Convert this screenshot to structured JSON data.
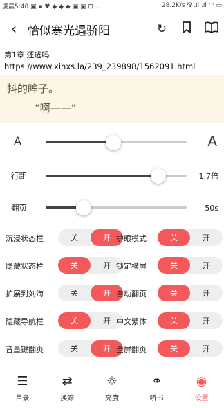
{
  "status_bar": {
    "left": "凌晨5:40 ▣ ▪ ♥ ◆ ◆ ◆ ▣ ▣ ⊡ …",
    "right": "28.2K/s ⅋ .ıl .ıl ◠ ▭"
  },
  "header": {
    "back_icon": "back-arrow-icon",
    "title": "恰似寒光遇骄阳",
    "icons": [
      "refresh-icon",
      "bookmark-icon",
      "book-icon"
    ]
  },
  "chapter": {
    "title": "第1章 还逃吗",
    "url": "https://www.xinxs.la/239_239898/1562091.html"
  },
  "reader": {
    "line1": "抖的眸子。",
    "line2": "“啊——”"
  },
  "settings": {
    "font_small": "A",
    "font_large": "A",
    "font_size_level": 0.48,
    "line_spacing": {
      "label": "行距",
      "value": "1.7倍",
      "level": 0.8
    },
    "page_turn": {
      "label": "翻页",
      "value": "50s",
      "level": 0.27
    },
    "toggles": [
      {
        "label": "沉浸状态栏",
        "off": "关",
        "on": "开",
        "state": "on"
      },
      {
        "label": "护眼模式",
        "off": "关",
        "on": "开",
        "state": "off"
      },
      {
        "label": "隐藏状态栏",
        "off": "关",
        "on": "开",
        "state": "off"
      },
      {
        "label": "锁定横屏",
        "off": "关",
        "on": "开",
        "state": "off"
      },
      {
        "label": "扩展到刘海",
        "off": "关",
        "on": "开",
        "state": "on"
      },
      {
        "label": "自动翻页",
        "off": "关",
        "on": "开",
        "state": "off"
      },
      {
        "label": "隐藏导航栏",
        "off": "关",
        "on": "开",
        "state": "off"
      },
      {
        "label": "中文繁体",
        "off": "关",
        "on": "开",
        "state": "off"
      },
      {
        "label": "音量键翻页",
        "off": "关",
        "on": "开",
        "state": "on"
      },
      {
        "label": "全屏翻页",
        "off": "关",
        "on": "开",
        "state": "off"
      }
    ]
  },
  "bottom_nav": [
    {
      "label": "目录",
      "icon": "list-icon"
    },
    {
      "label": "换源",
      "icon": "swap-icon"
    },
    {
      "label": "亮度",
      "icon": "brightness-icon"
    },
    {
      "label": "听书",
      "icon": "headphones-icon"
    },
    {
      "label": "设置",
      "icon": "settings-icon",
      "active": true
    }
  ],
  "colors": {
    "accent": "#f3585a",
    "reader_bg": "#fbf6e6"
  }
}
